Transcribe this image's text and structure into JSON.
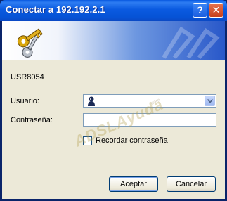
{
  "window": {
    "title": "Conectar a 192.192.2.1",
    "help_label": "?",
    "close_label": "✕"
  },
  "dialog": {
    "server_name": "USR8054",
    "user_label": "Usuario:",
    "user_value": "",
    "password_label": "Contraseña:",
    "password_value": "",
    "remember_label": "Recordar contraseña",
    "remember_checked": false,
    "ok_label": "Aceptar",
    "cancel_label": "Cancelar"
  },
  "watermark": {
    "text": "ADSLAyuda",
    "small_text": ".com"
  },
  "colors": {
    "titlebar": "#0a5ae0",
    "client_bg": "#ece9d8",
    "border": "#0a246a"
  }
}
